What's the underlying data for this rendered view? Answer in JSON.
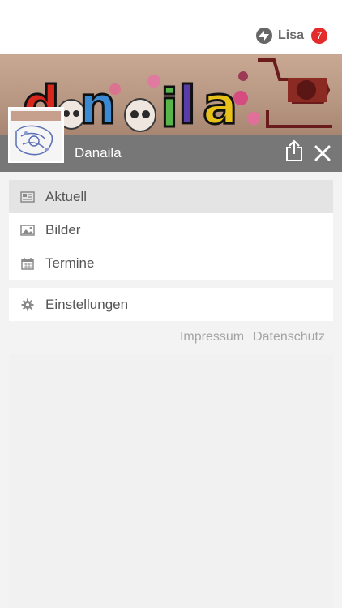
{
  "header": {
    "user_name": "Lisa",
    "notification_count": "7",
    "logo_icon": "app-logo-icon",
    "badge_color": "#e32b2b"
  },
  "banner": {
    "logo_text": "danaila",
    "avatar_caption": "danaila"
  },
  "page": {
    "name": "Danaila",
    "share_icon": "share-icon",
    "close_icon": "close-icon"
  },
  "menu": {
    "items": [
      {
        "label": "Aktuell",
        "icon": "newspaper-icon",
        "active": true
      },
      {
        "label": "Bilder",
        "icon": "image-icon",
        "active": false
      },
      {
        "label": "Termine",
        "icon": "calendar-icon",
        "active": false
      }
    ],
    "settings": {
      "label": "Einstellungen",
      "icon": "gear-icon"
    }
  },
  "footer": {
    "impressum": "Impressum",
    "datenschutz": "Datenschutz"
  }
}
